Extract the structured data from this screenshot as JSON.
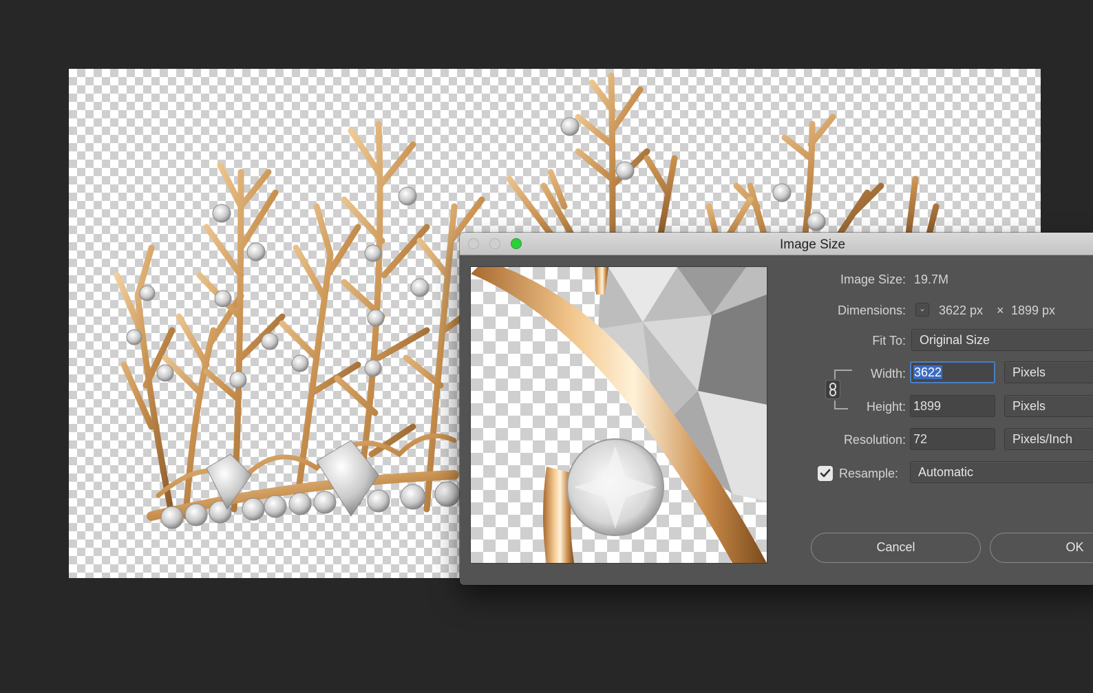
{
  "dialog": {
    "title": "Image Size",
    "image_size_label": "Image Size:",
    "image_size_value": "19.7M",
    "dimensions_label": "Dimensions:",
    "dimensions_width": "3622 px",
    "dimensions_times": "×",
    "dimensions_height": "1899 px",
    "fit_to_label": "Fit To:",
    "fit_to_value": "Original Size",
    "width_label": "Width:",
    "width_value": "3622",
    "width_unit": "Pixels",
    "height_label": "Height:",
    "height_value": "1899",
    "height_unit": "Pixels",
    "resolution_label": "Resolution:",
    "resolution_value": "72",
    "resolution_unit": "Pixels/Inch",
    "resample_label": "Resample:",
    "resample_checked": true,
    "resample_value": "Automatic",
    "cancel_label": "Cancel",
    "ok_label": "OK"
  },
  "icons": {
    "chain": "link-constrain-icon",
    "checkmark": "checkmark-icon",
    "chevron": "chevron-down-icon"
  },
  "colors": {
    "window_bg": "#272727",
    "dialog_bg": "#535353",
    "selection": "#3b6cc2",
    "zoom_button": "#2fcc3c"
  }
}
